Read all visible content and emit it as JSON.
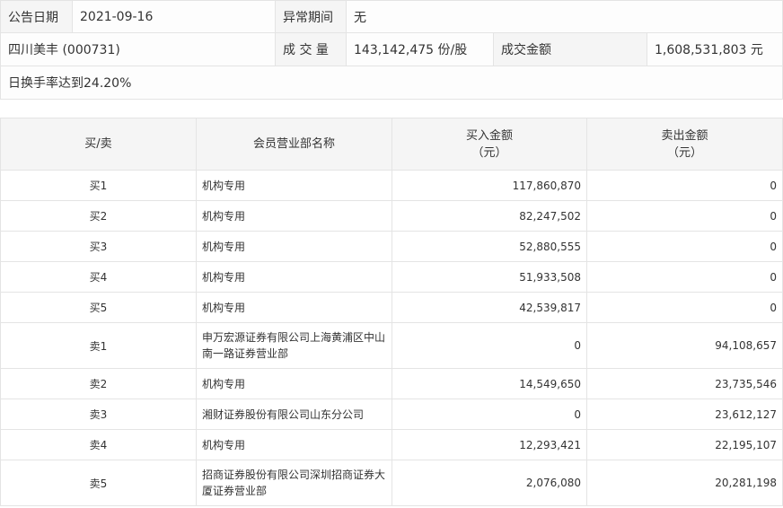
{
  "info": {
    "date_label": "公告日期",
    "date_value": "2021-09-16",
    "period_label": "异常期间",
    "period_value": "无",
    "stock": "四川美丰 (000731)",
    "volume_label": "成 交 量",
    "volume_value": "143,142,475 份/股",
    "amount_label": "成交金额",
    "amount_value": "1,608,531,803 元",
    "reason": "日换手率达到24.20%"
  },
  "headers": {
    "side": "买/卖",
    "name": "会员营业部名称",
    "buy": "买入金额\n（元）",
    "sell": "卖出金额\n（元）"
  },
  "rows": [
    {
      "side": "买1",
      "name": "机构专用",
      "buy": "117,860,870",
      "sell": "0"
    },
    {
      "side": "买2",
      "name": "机构专用",
      "buy": "82,247,502",
      "sell": "0"
    },
    {
      "side": "买3",
      "name": "机构专用",
      "buy": "52,880,555",
      "sell": "0"
    },
    {
      "side": "买4",
      "name": "机构专用",
      "buy": "51,933,508",
      "sell": "0"
    },
    {
      "side": "买5",
      "name": "机构专用",
      "buy": "42,539,817",
      "sell": "0"
    },
    {
      "side": "卖1",
      "name": "申万宏源证券有限公司上海黄浦区中山南一路证券营业部",
      "buy": "0",
      "sell": "94,108,657"
    },
    {
      "side": "卖2",
      "name": "机构专用",
      "buy": "14,549,650",
      "sell": "23,735,546"
    },
    {
      "side": "卖3",
      "name": "湘财证券股份有限公司山东分公司",
      "buy": "0",
      "sell": "23,612,127"
    },
    {
      "side": "卖4",
      "name": "机构专用",
      "buy": "12,293,421",
      "sell": "22,195,107"
    },
    {
      "side": "卖5",
      "name": "招商证券股份有限公司深圳招商证券大厦证券营业部",
      "buy": "2,076,080",
      "sell": "20,281,198"
    }
  ]
}
